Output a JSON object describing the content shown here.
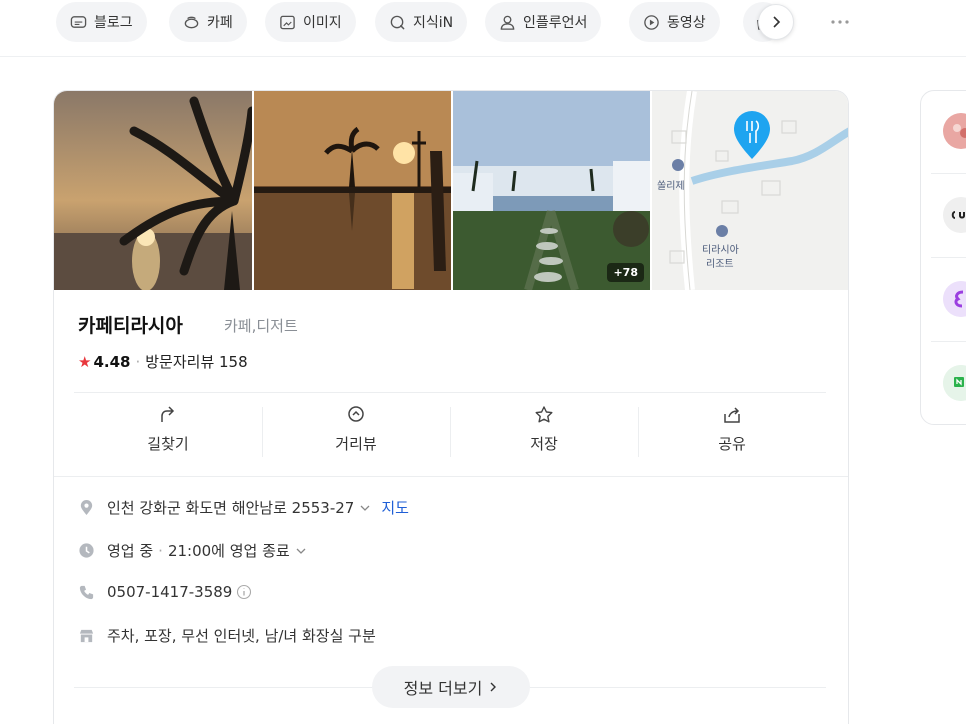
{
  "tabs": [
    {
      "label": "블로그",
      "icon": "blog-icon"
    },
    {
      "label": "카페",
      "icon": "cafe-icon"
    },
    {
      "label": "이미지",
      "icon": "image-icon"
    },
    {
      "label": "지식iN",
      "icon": "knowledge-icon"
    },
    {
      "label": "인플루언서",
      "icon": "influencer-icon"
    },
    {
      "label": "동영상",
      "icon": "video-icon"
    }
  ],
  "place": {
    "name": "카페티라시아",
    "category": "카페,디저트",
    "rating": "4.48",
    "review_label": "방문자리뷰 158",
    "photo_count": "+78",
    "map_labels": [
      "쏠리제",
      "티라시아",
      "리조트"
    ],
    "actions": [
      {
        "label": "길찾기",
        "icon": "directions-icon"
      },
      {
        "label": "거리뷰",
        "icon": "street-view-icon"
      },
      {
        "label": "저장",
        "icon": "star-icon"
      },
      {
        "label": "공유",
        "icon": "share-icon"
      }
    ],
    "address": "인천 강화군 화도면 해안남로 2553-27",
    "map_link": "지도",
    "hours": "영업 중",
    "hours_detail": "21:00에 영업 종료",
    "phone": "0507-1417-3589",
    "amenities": "주차, 포장, 무선 인터넷, 남/녀 화장실 구분",
    "more_info": "정보 더보기"
  },
  "colors": {
    "accent_link": "#1f5fd6",
    "star": "#e8373d",
    "map_pin": "#1ea4f0"
  }
}
